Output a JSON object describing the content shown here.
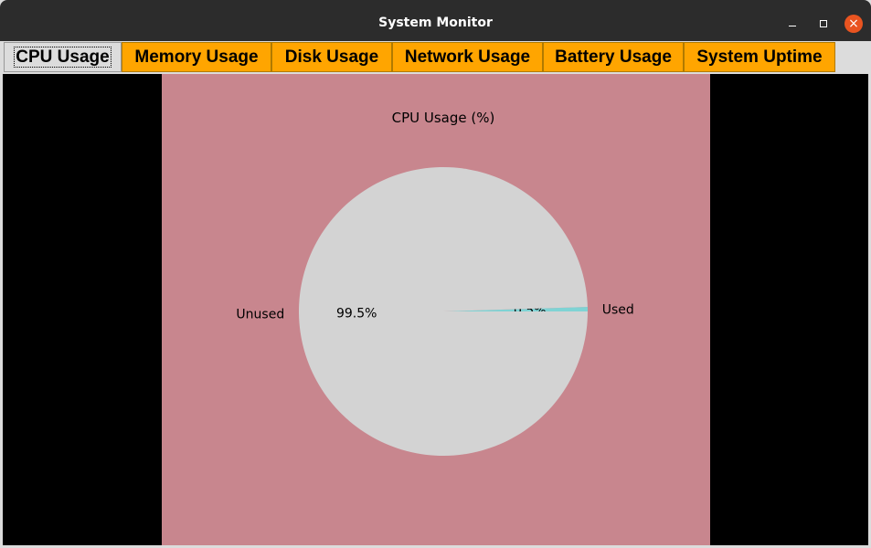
{
  "window": {
    "title": "System Monitor",
    "close_glyph": "×"
  },
  "tabs": [
    {
      "label": "CPU Usage",
      "active": true
    },
    {
      "label": "Memory Usage",
      "active": false
    },
    {
      "label": "Disk Usage",
      "active": false
    },
    {
      "label": "Network Usage",
      "active": false
    },
    {
      "label": "Battery Usage",
      "active": false
    },
    {
      "label": "System Uptime",
      "active": false
    }
  ],
  "chart_data": {
    "type": "pie",
    "title": "CPU Usage (%)",
    "slices": [
      {
        "label": "Used",
        "value": 0.5,
        "pct_label": "0.5%",
        "color": "#7fd3d4"
      },
      {
        "label": "Unused",
        "value": 99.5,
        "pct_label": "99.5%",
        "color": "#d3d3d3"
      }
    ],
    "background_color": "#c8868e"
  }
}
